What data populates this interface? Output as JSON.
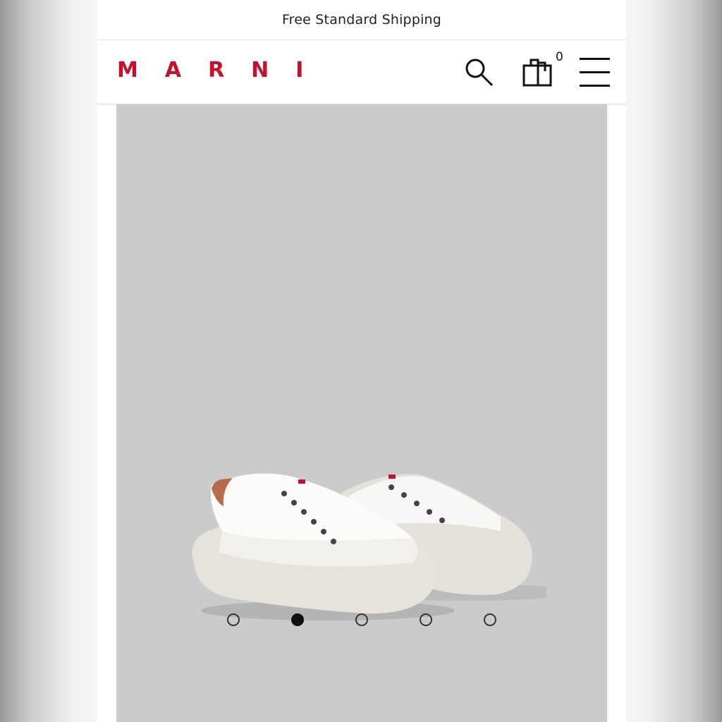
{
  "promo_banner": {
    "text": "Free Standard Shipping"
  },
  "header": {
    "logo_text": "MARNI",
    "logo_color": "#c8102e",
    "search_icon": "search-icon",
    "bag_icon": "shopping-bag-icon",
    "bag_count": "0",
    "menu_icon": "hamburger-menu-icon"
  },
  "gallery": {
    "image_subject": "white canvas low-top sneakers with oversized rubber sole",
    "background_color": "#cbcbcb",
    "dots_total": 5,
    "active_dot": 2
  }
}
